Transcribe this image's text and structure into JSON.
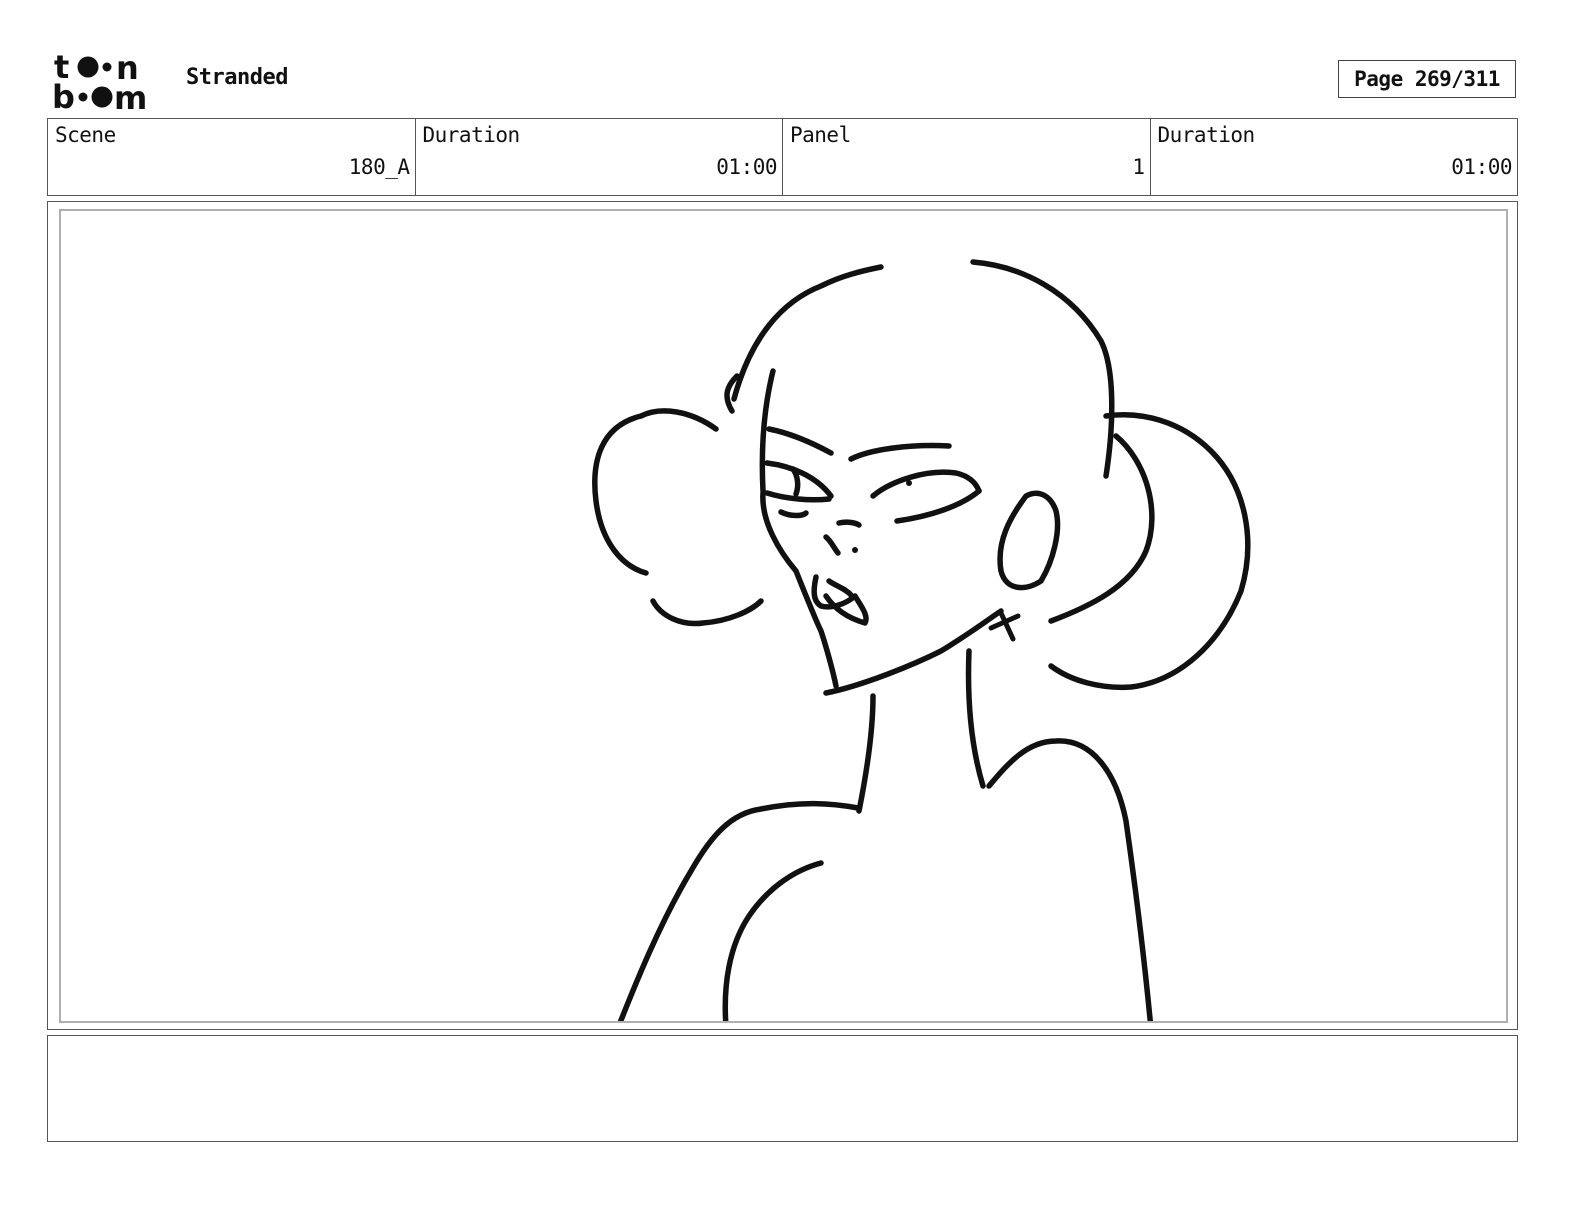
{
  "header": {
    "logo_lines": [
      "toon",
      "boom"
    ],
    "project_title": "Stranded",
    "page_indicator": "Page 269/311"
  },
  "info": {
    "scene_label": "Scene",
    "scene_value": "180_A",
    "scene_duration_label": "Duration",
    "scene_duration_value": "01:00",
    "panel_label": "Panel",
    "panel_value": "1",
    "panel_duration_label": "Duration",
    "panel_duration_value": "01:00"
  },
  "panel": {
    "drawing": "sketch-character"
  },
  "notes": {
    "text": ""
  }
}
